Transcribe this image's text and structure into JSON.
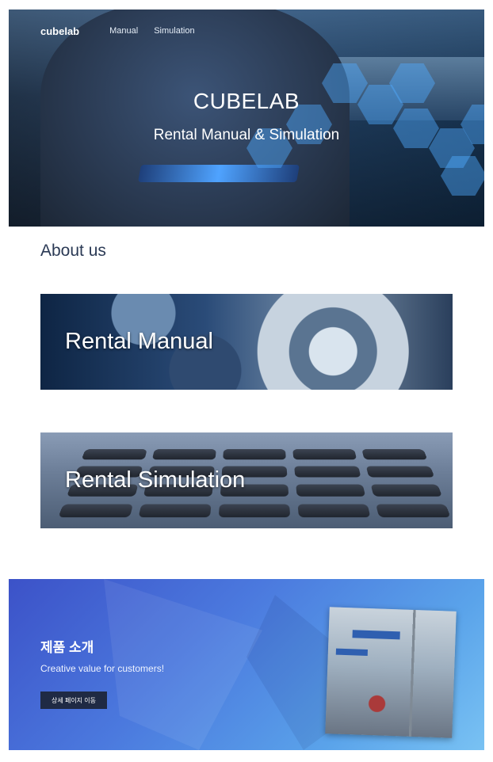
{
  "nav": {
    "logo": "cubelab",
    "links": [
      "Manual",
      "Simulation"
    ]
  },
  "hero": {
    "title": "CUBELAB",
    "subtitle": "Rental Manual & Simulation"
  },
  "about": {
    "heading": "About us"
  },
  "cards": [
    {
      "label": "Rental Manual"
    },
    {
      "label": "Rental Simulation"
    }
  ],
  "promo": {
    "title": "제품 소개",
    "text": "Creative value for customers!",
    "button": "상세 페이지 이동"
  },
  "colors": {
    "promo_gradient_start": "#3c52c8",
    "promo_gradient_end": "#79c2f3",
    "heading": "#2b3a55",
    "button_bg": "#1f2a44"
  }
}
